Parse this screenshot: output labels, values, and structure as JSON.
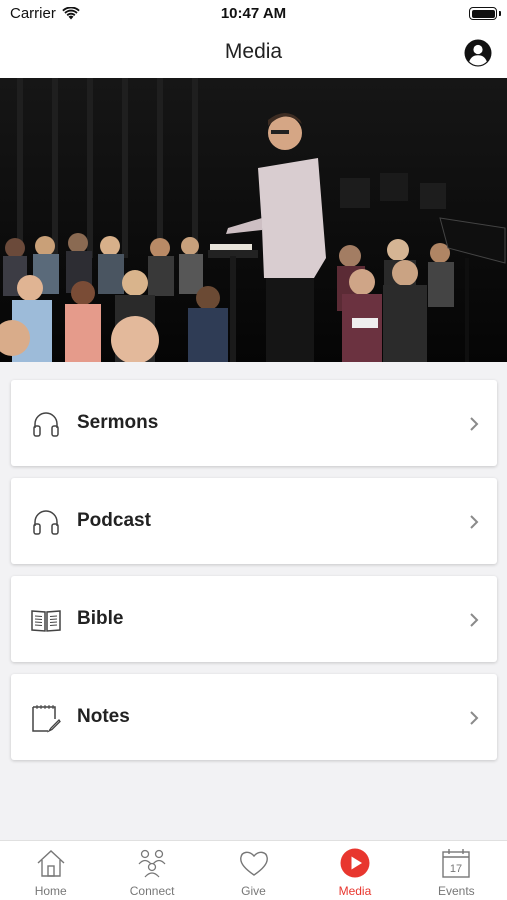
{
  "status_bar": {
    "carrier": "Carrier",
    "time": "10:47 AM"
  },
  "nav": {
    "title": "Media",
    "profile_icon": "user-circle-icon"
  },
  "hero": {
    "description_icon": "sermon-photo"
  },
  "menu": {
    "items": [
      {
        "label": "Sermons",
        "icon": "headphones-icon"
      },
      {
        "label": "Podcast",
        "icon": "headphones-icon"
      },
      {
        "label": "Bible",
        "icon": "book-icon"
      },
      {
        "label": "Notes",
        "icon": "notepad-icon"
      }
    ]
  },
  "tabs": {
    "items": [
      {
        "label": "Home",
        "icon": "home-icon"
      },
      {
        "label": "Connect",
        "icon": "people-icon"
      },
      {
        "label": "Give",
        "icon": "heart-icon"
      },
      {
        "label": "Media",
        "icon": "play-icon"
      },
      {
        "label": "Events",
        "icon": "calendar-icon"
      }
    ],
    "active": "Media",
    "active_color": "#e8362e",
    "inactive_color": "#777777"
  }
}
